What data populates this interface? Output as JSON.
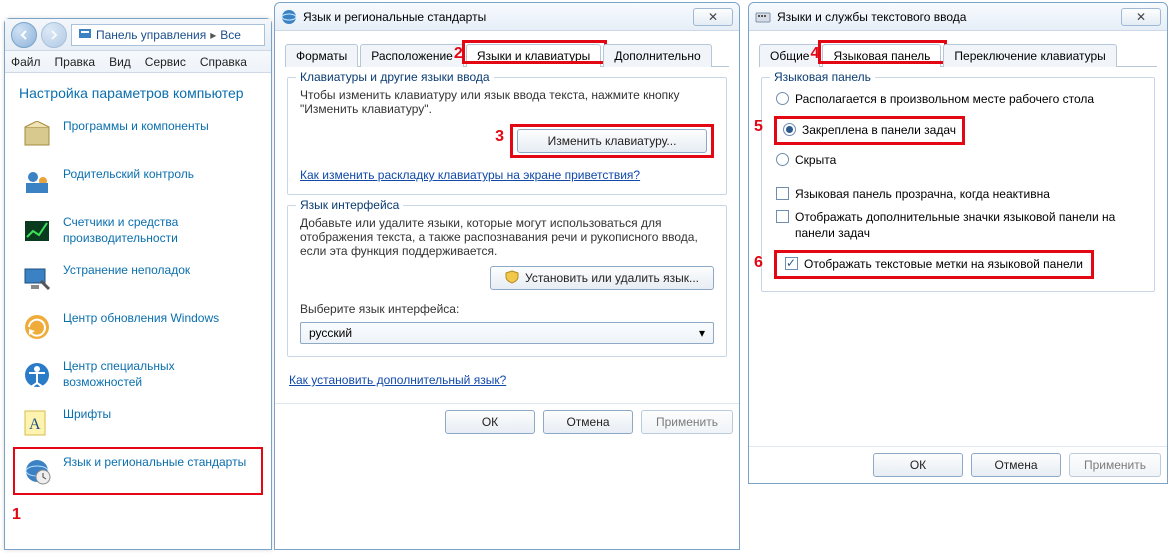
{
  "markers": {
    "m1": "1",
    "m2": "2",
    "m3": "3",
    "m4": "4",
    "m5": "5",
    "m6": "6"
  },
  "cp_window": {
    "address": {
      "part1": "Панель управления",
      "part2": "Все"
    },
    "menubar": [
      "Файл",
      "Правка",
      "Вид",
      "Сервис",
      "Справка"
    ],
    "heading": "Настройка параметров компьютер",
    "items": [
      "Программы и компоненты",
      "Родительский контроль",
      "Счетчики и средства производительности",
      "Устранение неполадок",
      "Центр обновления Windows",
      "Центр специальных возможностей",
      "Шрифты",
      "Язык и региональные стандарты"
    ]
  },
  "dlg1": {
    "title": "Язык и региональные стандарты",
    "tabs": [
      "Форматы",
      "Расположение",
      "Языки и клавиатуры",
      "Дополнительно"
    ],
    "group1_legend": "Клавиатуры и другие языки ввода",
    "group1_text": "Чтобы изменить клавиатуру или язык ввода текста, нажмите кнопку \"Изменить клавиатуру\".",
    "btn_change_kb": "Изменить клавиатуру...",
    "link1": "Как изменить раскладку клавиатуры на экране приветствия?",
    "group2_legend": "Язык интерфейса",
    "group2_text": "Добавьте или удалите языки, которые могут использоваться для отображения текста, а также распознавания речи и рукописного ввода, если эта функция поддерживается.",
    "btn_install_lang": "Установить или удалить язык...",
    "combo_label": "Выберите язык интерфейса:",
    "combo_value": "русский",
    "link2": "Как установить дополнительный язык?",
    "buttons": {
      "ok": "ОК",
      "cancel": "Отмена",
      "apply": "Применить"
    }
  },
  "dlg2": {
    "title": "Языки и службы текстового ввода",
    "tabs": [
      "Общие",
      "Языковая панель",
      "Переключение клавиатуры"
    ],
    "group_legend": "Языковая панель",
    "radios": [
      "Располагается в произвольном месте рабочего стола",
      "Закреплена в панели задач",
      "Скрыта"
    ],
    "checks": [
      "Языковая панель прозрачна, когда неактивна",
      "Отображать дополнительные значки языковой панели на панели задач",
      "Отображать текстовые метки на языковой панели"
    ],
    "buttons": {
      "ok": "ОК",
      "cancel": "Отмена",
      "apply": "Применить"
    }
  }
}
